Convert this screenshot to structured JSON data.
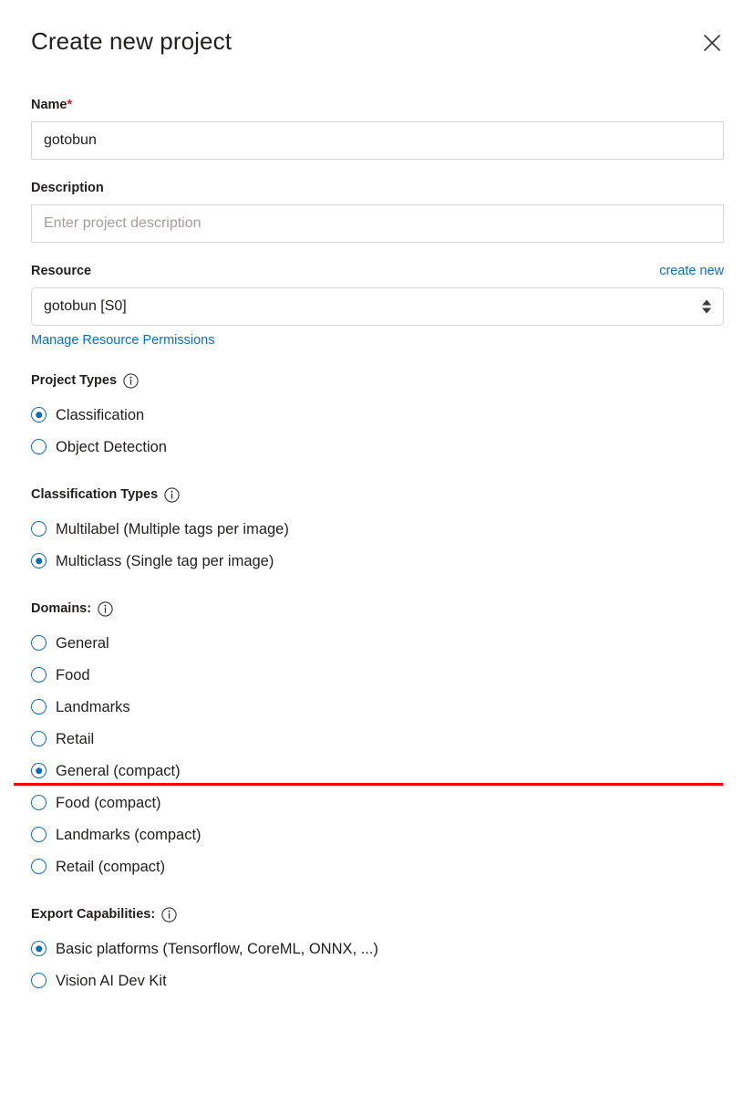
{
  "dialog": {
    "title": "Create new project",
    "close_icon": "close-icon"
  },
  "name_field": {
    "label": "Name",
    "required_marker": "*",
    "value": "gotobun",
    "placeholder": ""
  },
  "description_field": {
    "label": "Description",
    "value": "",
    "placeholder": "Enter project description"
  },
  "resource_field": {
    "label": "Resource",
    "create_new_label": "create new",
    "selected": "gotobun [S0]",
    "options": [
      "gotobun [S0]"
    ],
    "manage_permissions_label": "Manage Resource Permissions"
  },
  "project_types": {
    "heading": "Project Types",
    "info_icon": "info-icon",
    "options": [
      {
        "label": "Classification",
        "checked": true
      },
      {
        "label": "Object Detection",
        "checked": false
      }
    ]
  },
  "classification_types": {
    "heading": "Classification Types",
    "info_icon": "info-icon",
    "options": [
      {
        "label": "Multilabel (Multiple tags per image)",
        "checked": false
      },
      {
        "label": "Multiclass (Single tag per image)",
        "checked": true
      }
    ]
  },
  "domains": {
    "heading": "Domains:",
    "info_icon": "info-icon",
    "options": [
      {
        "label": "General",
        "checked": false
      },
      {
        "label": "Food",
        "checked": false
      },
      {
        "label": "Landmarks",
        "checked": false
      },
      {
        "label": "Retail",
        "checked": false
      },
      {
        "label": "General (compact)",
        "checked": true
      },
      {
        "label": "Food (compact)",
        "checked": false
      },
      {
        "label": "Landmarks (compact)",
        "checked": false
      },
      {
        "label": "Retail (compact)",
        "checked": false
      }
    ]
  },
  "export_capabilities": {
    "heading": "Export Capabilities:",
    "info_icon": "info-icon",
    "options": [
      {
        "label": "Basic platforms (Tensorflow, CoreML, ONNX, ...)",
        "checked": true
      },
      {
        "label": "Vision AI Dev Kit",
        "checked": false
      }
    ]
  },
  "annotation": {
    "underline_color": "#ff0000",
    "target_label": "General (compact)"
  },
  "colors": {
    "accent": "#0f6cbd",
    "link": "#0f6cbd",
    "required": "#e81123",
    "text": "#201f1e",
    "border": "#d6d6d6",
    "placeholder": "#a19f9d"
  }
}
